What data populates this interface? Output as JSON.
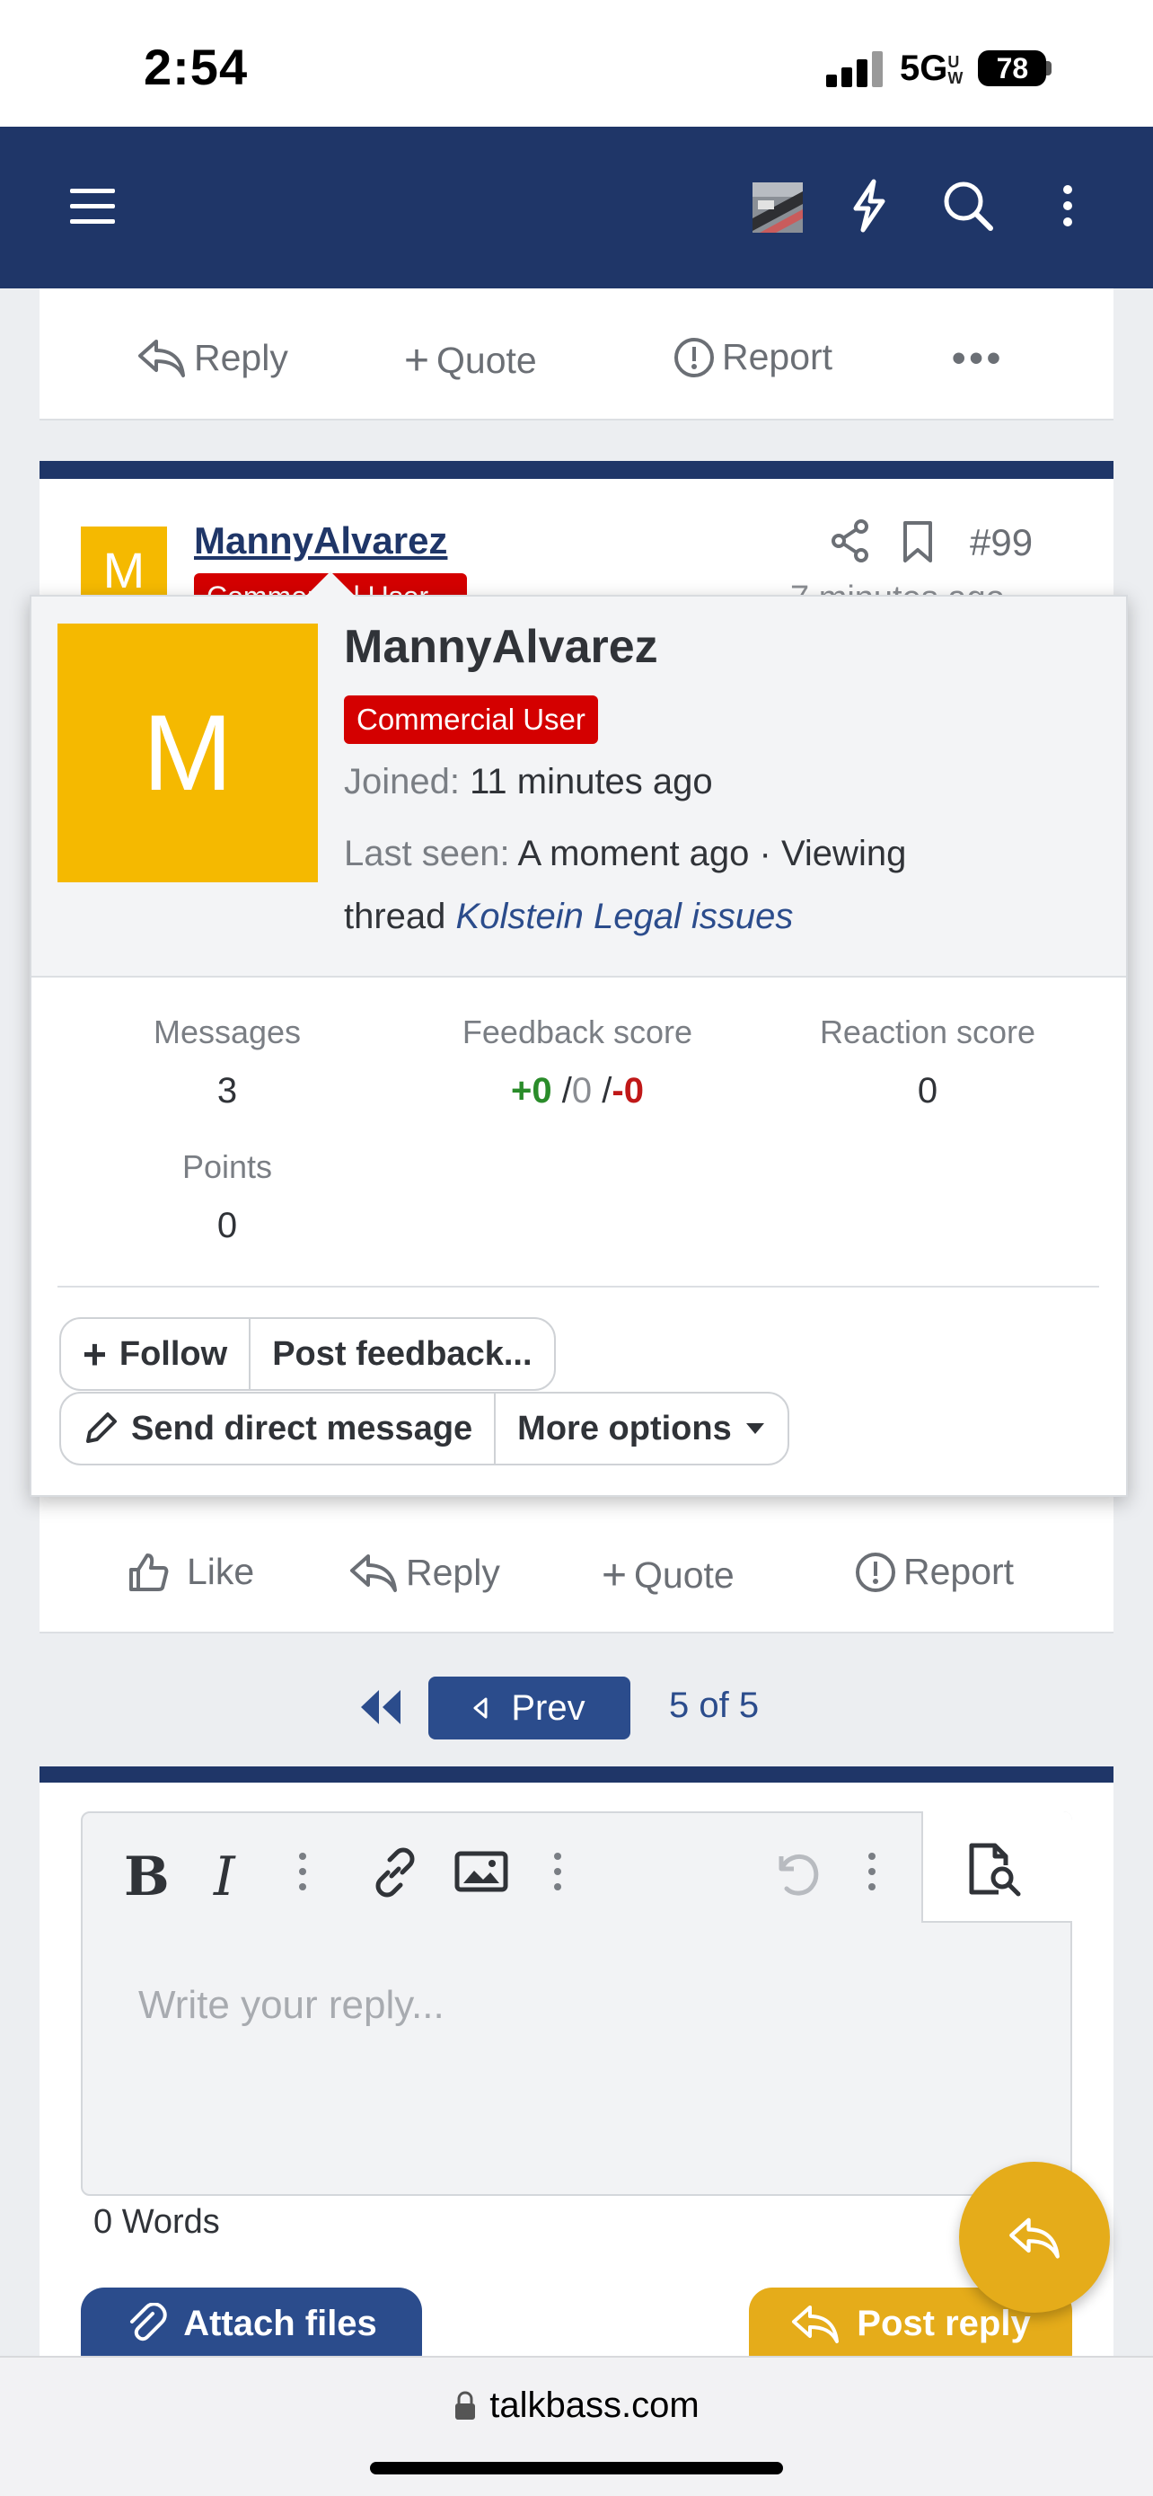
{
  "status_bar": {
    "time": "2:54",
    "network": "5G",
    "network_sup": "UW",
    "battery": "78"
  },
  "nav": {
    "menu_icon": "hamburger-icon",
    "bolt_icon": "bolt-icon",
    "search_icon": "search-icon",
    "more_icon": "vertical-dots-icon"
  },
  "prev_post_actions": {
    "reply": "Reply",
    "quote": "Quote",
    "report": "Report",
    "more": "•••"
  },
  "post": {
    "username": "MannyAlvarez",
    "badge_peek": "Commercial User",
    "avatar_letter": "M",
    "number": "#99",
    "time_peek": "7 minutes ago",
    "actions": {
      "like": "Like",
      "reply": "Reply",
      "quote": "Quote",
      "report": "Report"
    }
  },
  "popup": {
    "avatar_letter": "M",
    "username": "MannyAlvarez",
    "badge": "Commercial User",
    "joined_label": "Joined:",
    "joined_value": "11 minutes ago",
    "last_seen_label": "Last seen:",
    "last_seen_value": "A moment ago · Viewing",
    "thread_prefix": "thread",
    "thread_link": "Kolstein Legal issues",
    "stats": {
      "messages_label": "Messages",
      "messages_value": "3",
      "feedback_label": "Feedback score",
      "feedback_pos": "+0",
      "feedback_neu": "0",
      "feedback_neg": "-0",
      "feedback_sep": "/",
      "reaction_label": "Reaction score",
      "reaction_value": "0",
      "points_label": "Points",
      "points_value": "0"
    },
    "buttons": {
      "follow": "Follow",
      "post_feedback": "Post feedback...",
      "send_dm": "Send direct message",
      "more_options": "More options"
    }
  },
  "pager": {
    "prev": "Prev",
    "count": "5 of 5"
  },
  "editor": {
    "placeholder": "Write your reply...",
    "word_count": "0 Words",
    "bold": "B",
    "italic": "I"
  },
  "buttons": {
    "attach": "Attach files",
    "post_reply": "Post reply"
  },
  "browser": {
    "url": "talkbass.com"
  },
  "colors": {
    "nav_bg": "#1f3668",
    "accent_blue": "#2b4c8c",
    "badge_red": "#d40000",
    "avatar_yellow": "#f5b900",
    "reply_gold": "#e5ac1a"
  }
}
